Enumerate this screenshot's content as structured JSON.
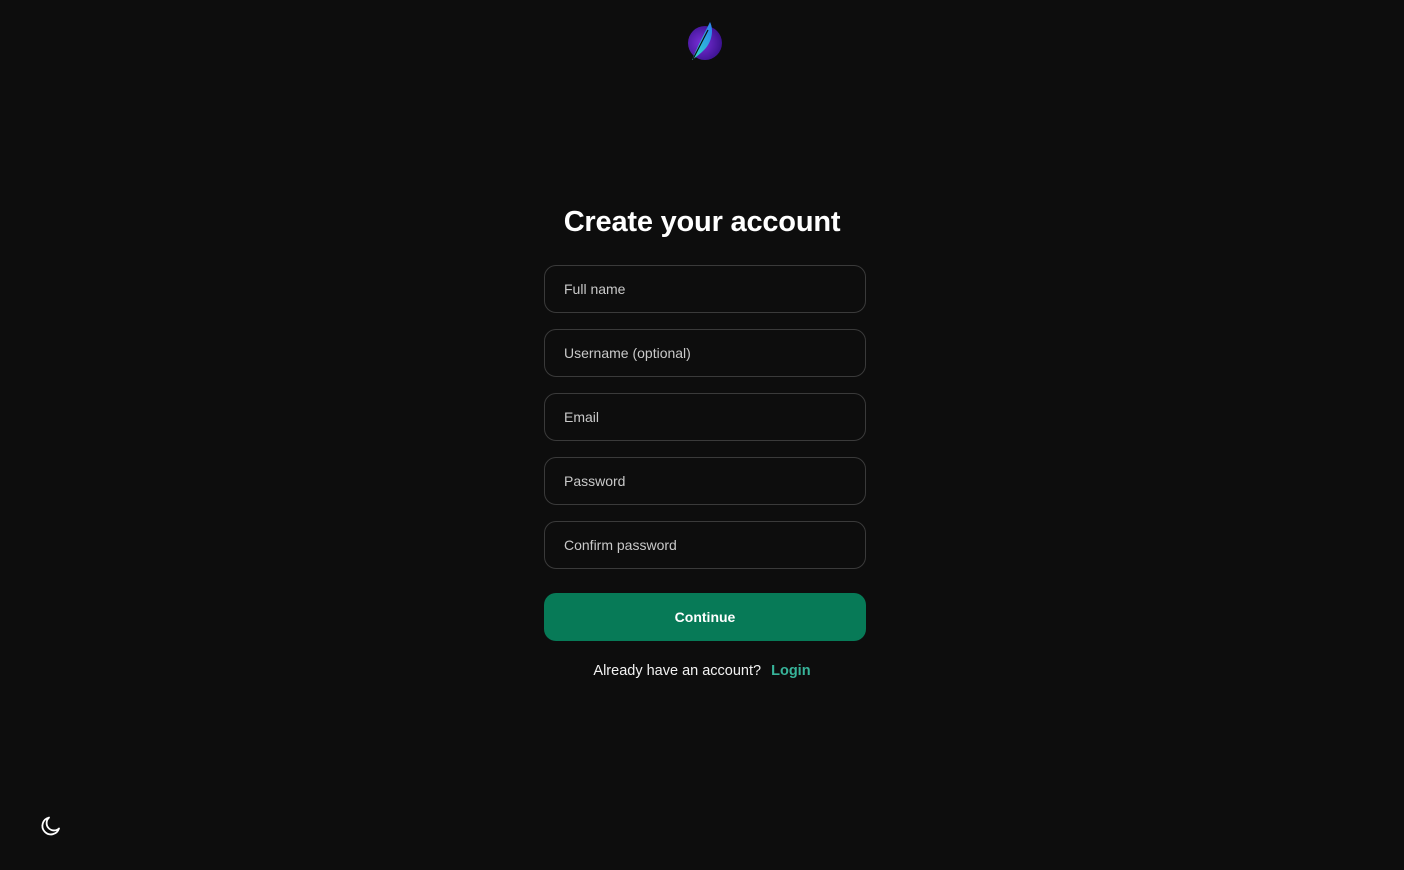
{
  "brand": {
    "logo_icon": "feather-logo-icon",
    "colors": {
      "logo_purple": "#5b1fb8",
      "logo_teal": "#1ec9c9"
    }
  },
  "signup": {
    "title": "Create your account",
    "fields": {
      "full_name": {
        "placeholder": "Full name",
        "value": ""
      },
      "username": {
        "placeholder": "Username (optional)",
        "value": ""
      },
      "email": {
        "placeholder": "Email",
        "value": ""
      },
      "password": {
        "placeholder": "Password",
        "value": ""
      },
      "confirm_password": {
        "placeholder": "Confirm password",
        "value": ""
      }
    },
    "continue_label": "Continue",
    "already_prompt": "Already have an account?",
    "login_label": "Login"
  },
  "theme_toggle": {
    "icon": "moon-icon"
  },
  "colors": {
    "background": "#0d0d0d",
    "primary_button": "#077a57",
    "link": "#37b49a",
    "field_border": "#3a3a3a"
  }
}
